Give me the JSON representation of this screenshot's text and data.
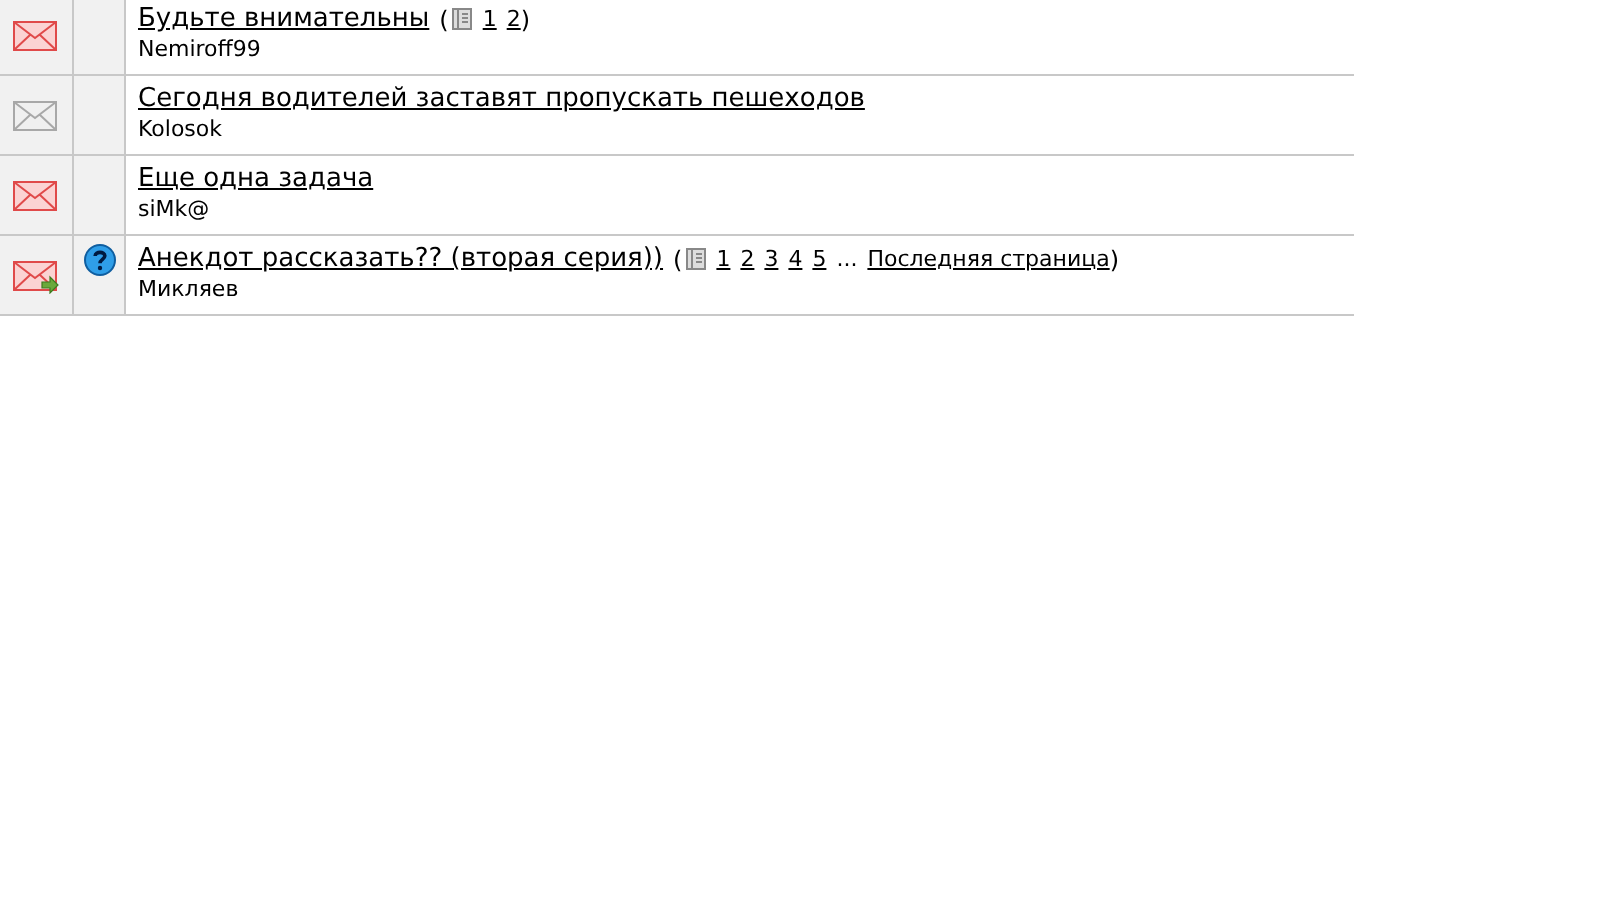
{
  "topics": [
    {
      "kind": "new",
      "question": false,
      "title": "Будьте внимательны",
      "pagination": {
        "open": "(",
        "pages": [
          "1",
          "2"
        ],
        "close": ")"
      },
      "author": "Nemiroff99"
    },
    {
      "kind": "read",
      "question": false,
      "title": "Сегодня водителей заставят пропускать пешеходов",
      "author": "Kolosok"
    },
    {
      "kind": "new",
      "question": false,
      "title": "Еще одна задача",
      "author": "siMk@"
    },
    {
      "kind": "moved",
      "question": true,
      "title": "Анекдот рассказать?? (вторая серия))",
      "pagination": {
        "open": "(",
        "pages": [
          "1",
          "2",
          "3",
          "4",
          "5"
        ],
        "ellipsis": "...",
        "last": "Последняя страница",
        "close": ")"
      },
      "author": "Микляев"
    }
  ]
}
